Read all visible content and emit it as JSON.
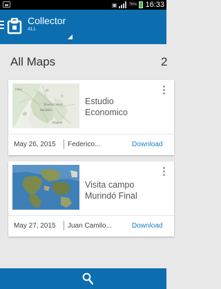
{
  "status_bar": {
    "battery_percent": "76%",
    "time": "16:33",
    "icons": [
      "gallery-icon",
      "nfc-icon",
      "signal-icon",
      "battery-icon"
    ]
  },
  "app_bar": {
    "title": "Collector",
    "subtitle": "ALL"
  },
  "section": {
    "title": "All Maps",
    "count": "2"
  },
  "maps": [
    {
      "title_line1": "Estudio",
      "title_line2": "Economico",
      "date": "May 26, 2015",
      "author": "Federico...",
      "action": "Download",
      "thumb_labels": [
        "Lima",
        "Buenos Aires",
        "Medellín",
        "Bogotá"
      ]
    },
    {
      "title_line1": "Visita campo",
      "title_line2": "Murindó Final",
      "date": "May 27, 2015",
      "author": "Juan Camilo...",
      "action": "Download"
    }
  ],
  "colors": {
    "brand": "#0c6eaf",
    "link": "#1a7fc4",
    "background": "#e8e8e8"
  }
}
